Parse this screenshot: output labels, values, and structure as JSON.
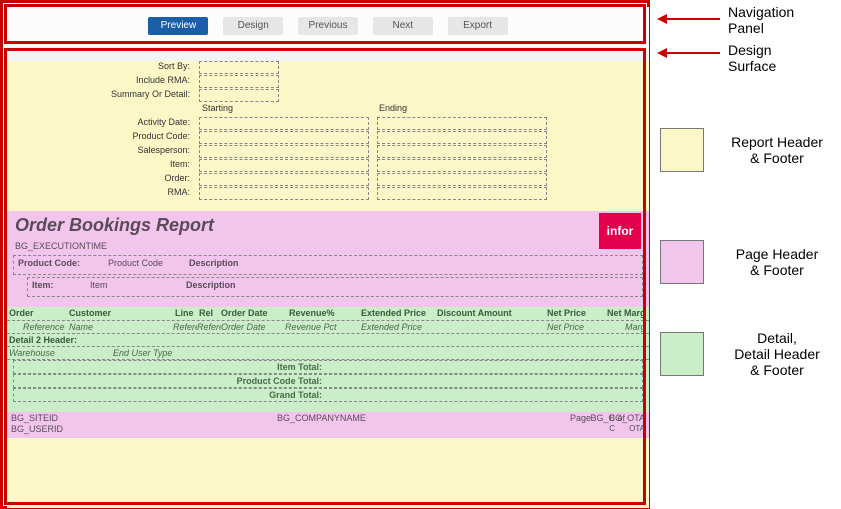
{
  "nav": {
    "preview": "Preview",
    "design": "Design",
    "previous": "Previous",
    "next": "Next",
    "export": "Export"
  },
  "legend": {
    "nav_panel_l1": "Navigation",
    "nav_panel_l2": "Panel",
    "design_surface_l1": "Design",
    "design_surface_l2": "Surface",
    "report_hf_l1": "Report Header",
    "report_hf_l2": "& Footer",
    "page_hf_l1": "Page Header",
    "page_hf_l2": "& Footer",
    "detail_l1": "Detail,",
    "detail_l2": "Detail Header",
    "detail_l3": "& Footer"
  },
  "params": {
    "sort_by": "Sort By:",
    "include_rma": "Include RMA:",
    "summary_or_detail": "Summary Or Detail:",
    "starting": "Starting",
    "ending": "Ending",
    "activity_date": "Activity Date:",
    "product_code": "Product Code:",
    "salesperson": "Salesperson:",
    "item": "Item:",
    "order": "Order:",
    "rma": "RMA:"
  },
  "page_header": {
    "title": "Order Bookings Report",
    "logo_text": "infor",
    "exec_time": "BG_EXECUTIONTIME",
    "pc_label": "Product Code:",
    "pc_value": "Product Code",
    "pc_desc": "Description",
    "item_label": "Item:",
    "item_value": "Item",
    "item_desc": "Description"
  },
  "detail": {
    "heads": {
      "order": "Order",
      "customer": "Customer",
      "line": "Line",
      "rel": "Rel",
      "order_date": "Order Date",
      "revenue_pct": "Revenue%",
      "extended_price": "Extended Price",
      "discount_amount": "Discount Amount",
      "net_price": "Net Price",
      "net_margin": "Net Marg"
    },
    "fields": {
      "reference": "Reference",
      "name": "Name",
      "refere1": "Refere",
      "refere2": "Refere",
      "order_date": "Order Date",
      "revenue_pct": "Revenue Pct",
      "extended_price": "Extended Price",
      "net_price": "Net Price",
      "marg": "Marg"
    },
    "detail2_header": "Detail 2 Header:",
    "warehouse": "Warehouse",
    "end_user_type": "End User Type",
    "item_total": "Item Total:",
    "product_code_total": "Product Code Total:",
    "grand_total": "Grand Total:"
  },
  "page_footer": {
    "bg_siteid": "BG_SITEID",
    "bg_userid": "BG_USERID",
    "bg_companyname": "BG_COMPANYNAME",
    "page_label": "Page",
    "bg_c": "BG_C",
    "of_label": "of",
    "bg_ota": "BG_OTA"
  },
  "colors": {
    "yellow": "#fbf7c6",
    "pink": "#f2c6ec",
    "green": "#c9eec8"
  }
}
